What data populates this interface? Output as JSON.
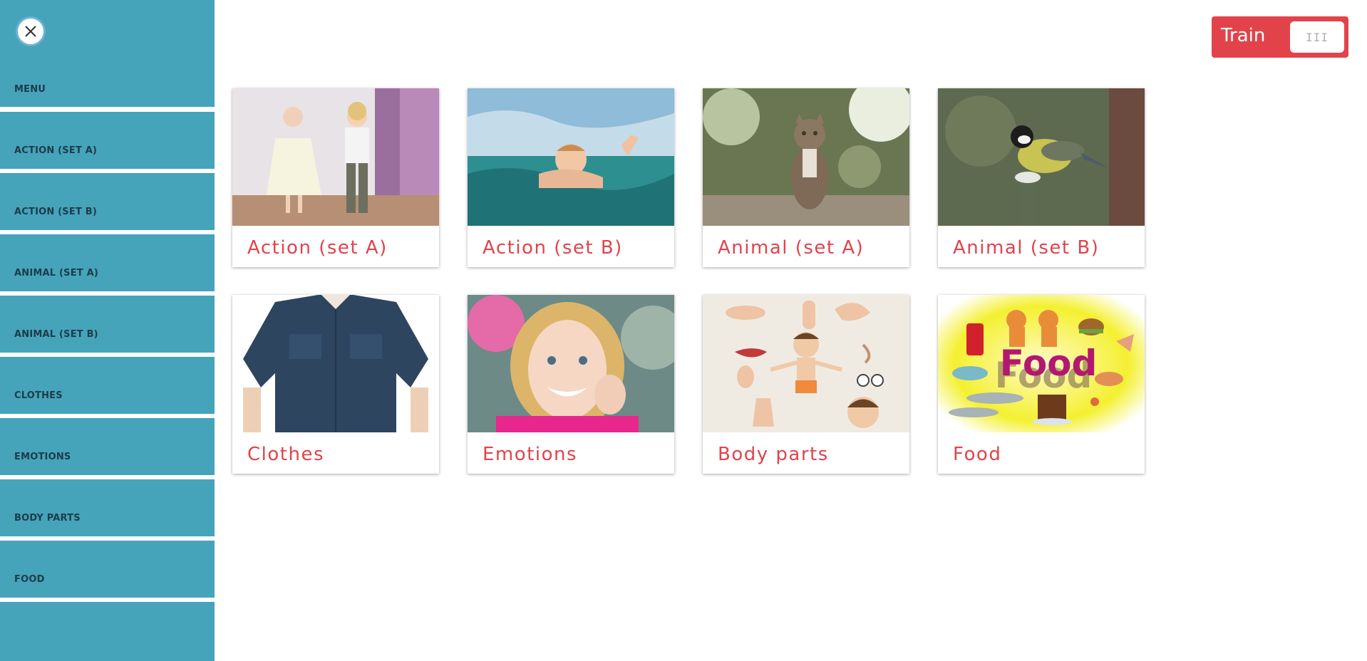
{
  "sidebar": {
    "close_icon": "close-icon",
    "items": [
      {
        "label": "MENU"
      },
      {
        "label": "ACTION (SET A)"
      },
      {
        "label": "ACTION (SET B)"
      },
      {
        "label": "ANIMAL (SET A)"
      },
      {
        "label": "ANIMAL (SET B)"
      },
      {
        "label": "CLOTHES"
      },
      {
        "label": "EMOTIONS"
      },
      {
        "label": "BODY PARTS"
      },
      {
        "label": "FOOD"
      }
    ],
    "color": "#45a4b9"
  },
  "train": {
    "label": "Train",
    "toggle_glyph": "III",
    "color": "#e2434b"
  },
  "cards": [
    {
      "label": "Action (set A)"
    },
    {
      "label": "Action (set B)"
    },
    {
      "label": "Animal (set A)"
    },
    {
      "label": "Animal (set B)"
    },
    {
      "label": "Clothes"
    },
    {
      "label": "Emotions"
    },
    {
      "label": "Body parts"
    },
    {
      "label": "Food"
    }
  ],
  "food_image_text": "Food"
}
